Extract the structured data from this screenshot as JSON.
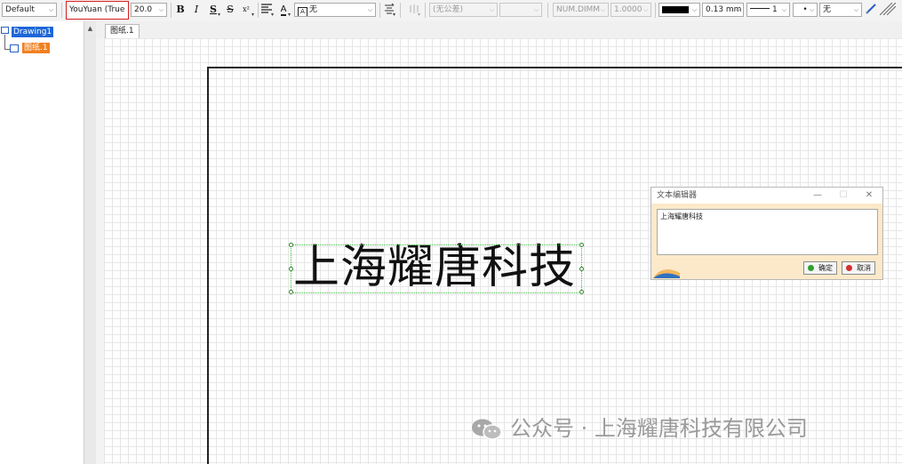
{
  "toolbar": {
    "style_combo": "Default",
    "font_combo": "YouYuan (True",
    "size_combo": "20.0",
    "bold_label": "B",
    "italic_label": "I",
    "underline_label": "S",
    "strike_label": "S",
    "superscript_label": "x²",
    "frame_combo": "无",
    "tolerance_combo": "(无公差)",
    "dim_combo": "NUM.DIMM",
    "dim_value_combo": "1.0000",
    "linewidth_combo": "0.13 mm",
    "linetype_combo": "1",
    "point_combo": "•",
    "pattern_combo": "无",
    "colors": {
      "highlight": "#d62020",
      "line_color": "#000000"
    }
  },
  "tree": {
    "root_label": "Drawing1",
    "sheet_label": "图纸.1"
  },
  "tabs": [
    {
      "label": "图纸.1"
    }
  ],
  "canvas": {
    "text": "上海耀唐科技",
    "selection_color": "#34c234"
  },
  "dialog": {
    "title": "文本编辑器",
    "content": "上海耀唐科技",
    "ok_label": "确定",
    "cancel_label": "取消"
  },
  "watermark": {
    "text": "公众号 · 上海耀唐科技有限公司"
  }
}
